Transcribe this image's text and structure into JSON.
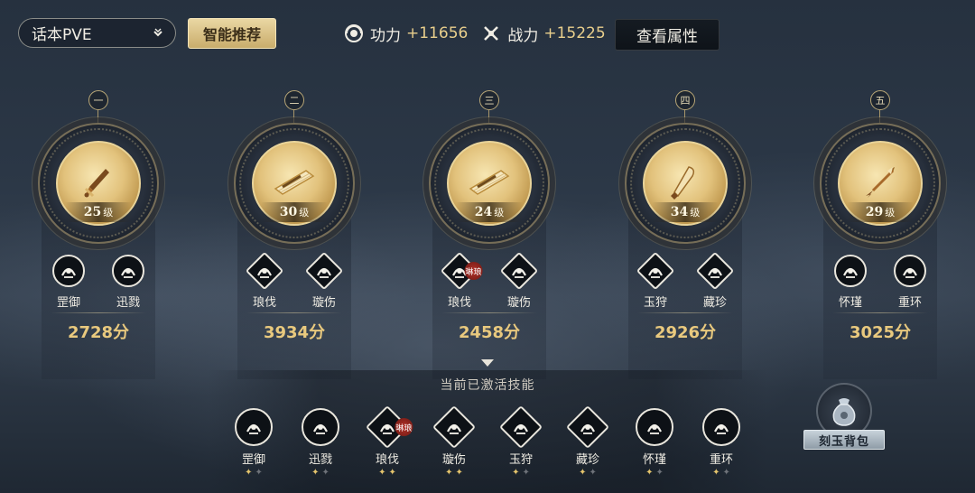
{
  "top": {
    "mode_value": "话本PVE",
    "smart_label": "智能推荐",
    "power_label": "功力",
    "power_value": "+11656",
    "combat_label": "战力",
    "combat_value": "+15225",
    "attr_button": "查看属性"
  },
  "slots": [
    {
      "index": "一",
      "level": "25",
      "level_unit": "级",
      "weapon": "sword",
      "skills": [
        {
          "name": "罡御",
          "shape": "circle"
        },
        {
          "name": "迅戮",
          "shape": "circle"
        }
      ],
      "score": "2728",
      "score_unit": "分"
    },
    {
      "index": "二",
      "level": "30",
      "level_unit": "级",
      "weapon": "fan",
      "skills": [
        {
          "name": "琅伐",
          "shape": "diamond"
        },
        {
          "name": "璇伤",
          "shape": "diamond"
        }
      ],
      "score": "3934",
      "score_unit": "分"
    },
    {
      "index": "三",
      "level": "24",
      "level_unit": "级",
      "weapon": "fan",
      "skills": [
        {
          "name": "琅伐",
          "shape": "diamond",
          "tag": "琳琅"
        },
        {
          "name": "璇伤",
          "shape": "diamond"
        }
      ],
      "score": "2458",
      "score_unit": "分"
    },
    {
      "index": "四",
      "level": "34",
      "level_unit": "级",
      "weapon": "blade",
      "skills": [
        {
          "name": "玉狩",
          "shape": "diamond"
        },
        {
          "name": "藏珍",
          "shape": "diamond"
        }
      ],
      "score": "2926",
      "score_unit": "分"
    },
    {
      "index": "五",
      "level": "29",
      "level_unit": "级",
      "weapon": "spear",
      "skills": [
        {
          "name": "怀瑾",
          "shape": "circle"
        },
        {
          "name": "重环",
          "shape": "circle"
        }
      ],
      "score": "3025",
      "score_unit": "分"
    }
  ],
  "active": {
    "title": "当前已激活技能",
    "skills": [
      {
        "name": "罡御",
        "shape": "circle",
        "stars": [
          1,
          0
        ]
      },
      {
        "name": "迅戮",
        "shape": "circle",
        "stars": [
          1,
          0
        ]
      },
      {
        "name": "琅伐",
        "shape": "diamond",
        "tag": "琳琅",
        "stars": [
          1,
          1
        ]
      },
      {
        "name": "璇伤",
        "shape": "diamond",
        "stars": [
          1,
          1
        ]
      },
      {
        "name": "玉狩",
        "shape": "diamond",
        "stars": [
          1,
          0
        ]
      },
      {
        "name": "藏珍",
        "shape": "diamond",
        "stars": [
          1,
          0
        ]
      },
      {
        "name": "怀瑾",
        "shape": "circle",
        "stars": [
          1,
          0
        ]
      },
      {
        "name": "重环",
        "shape": "circle",
        "stars": [
          1,
          0
        ]
      }
    ]
  },
  "bag": {
    "label": "刻玉背包"
  },
  "colors": {
    "gold": "#e9c97e",
    "accent_num": "#e9cf8c",
    "seal_red": "#b3322a"
  },
  "icons": {
    "mode_chevron": "chevron-down-icon",
    "power": "yin-yang-icon",
    "combat": "crossed-blades-icon",
    "bag": "pouch-icon"
  }
}
